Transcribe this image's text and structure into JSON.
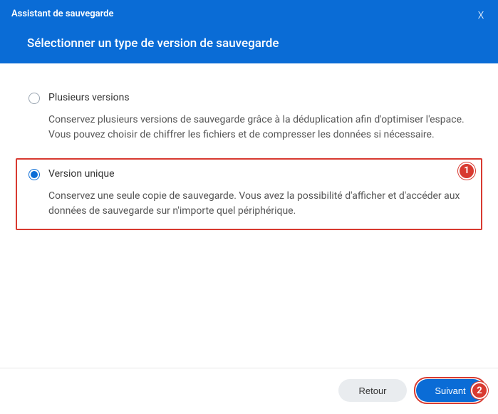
{
  "header": {
    "title": "Assistant de sauvegarde",
    "subtitle": "Sélectionner un type de version de sauvegarde",
    "close_symbol": "x"
  },
  "options": {
    "multi": {
      "label": "Plusieurs versions",
      "description": "Conservez plusieurs versions de sauvegarde grâce à la déduplication afin d'optimiser l'espace. Vous pouvez choisir de chiffrer les fichiers et de compresser les données si nécessaire.",
      "selected": false
    },
    "single": {
      "label": "Version unique",
      "description": "Conservez une seule copie de sauvegarde. Vous avez la possibilité d'afficher et d'accéder aux données de sauvegarde sur n'importe quel périphérique.",
      "selected": true
    }
  },
  "callouts": {
    "option_badge": "1",
    "next_badge": "2"
  },
  "footer": {
    "back_label": "Retour",
    "next_label": "Suivant"
  },
  "colors": {
    "primary": "#0a6cd6",
    "callout": "#d83a30"
  }
}
